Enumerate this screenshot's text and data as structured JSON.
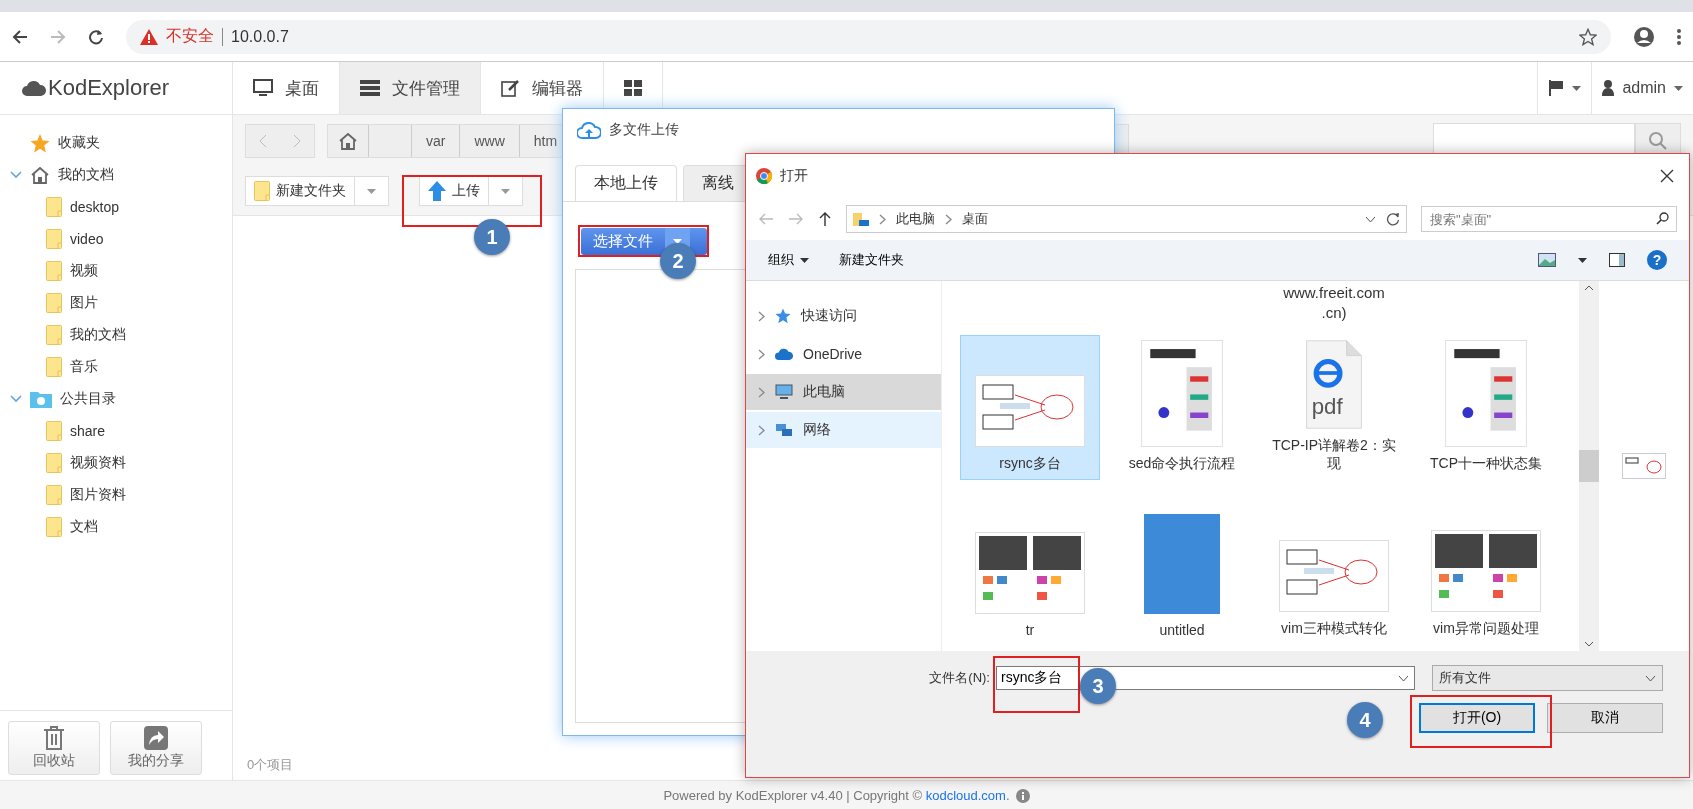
{
  "browser": {
    "warning": "不安全",
    "url": "10.0.0.7"
  },
  "app": {
    "logo": "KodExplorer",
    "nav": [
      {
        "label": "桌面",
        "selected": false,
        "kind": "desktop"
      },
      {
        "label": "文件管理",
        "selected": true,
        "kind": "files"
      },
      {
        "label": "编辑器",
        "selected": false,
        "kind": "editor"
      },
      {
        "kind": "apps",
        "selected": false
      }
    ],
    "user": "admin"
  },
  "sidebar": {
    "items": [
      {
        "label": "收藏夹",
        "kind": "star"
      },
      {
        "label": "我的文档",
        "kind": "home",
        "expanded": true,
        "children": [
          {
            "label": "desktop"
          },
          {
            "label": "video"
          },
          {
            "label": "视频"
          },
          {
            "label": "图片"
          },
          {
            "label": "我的文档"
          },
          {
            "label": "音乐"
          }
        ]
      },
      {
        "label": "公共目录",
        "kind": "public",
        "expanded": true,
        "children": [
          {
            "label": "share"
          },
          {
            "label": "视频资料"
          },
          {
            "label": "图片资料"
          },
          {
            "label": "文档"
          }
        ]
      }
    ],
    "buttons": [
      {
        "label": "回收站",
        "kind": "trash"
      },
      {
        "label": "我的分享",
        "kind": "share"
      }
    ]
  },
  "breadcrumb": [
    "var",
    "www",
    "htm"
  ],
  "toolbar": {
    "new_folder": "新建文件夹",
    "upload": "上传"
  },
  "status": "0个项目",
  "footer": {
    "text": "Powered by KodExplorer v4.40 | Copyright © ",
    "link": "kodcloud.com",
    "end": "."
  },
  "upload_dialog": {
    "title": "多文件上传",
    "tabs": [
      {
        "label": "本地上传",
        "selected": true
      },
      {
        "label": "离线",
        "selected": false
      }
    ],
    "button": "选择文件"
  },
  "open_dialog": {
    "title": "打开",
    "path": [
      "此电脑",
      "桌面"
    ],
    "search_placeholder": "搜索\"桌面\"",
    "organize": "组织",
    "help": "?",
    "new_folder": "新建文件夹",
    "nav": [
      {
        "label": "快速访问",
        "kind": "quick",
        "selected": false
      },
      {
        "label": "OneDrive",
        "kind": "cloud",
        "selected": false
      },
      {
        "label": "此电脑",
        "kind": "pc",
        "selected": true
      },
      {
        "label": "网络",
        "kind": "network",
        "selected": false,
        "hovered": true
      }
    ],
    "partial_label": "www.freeit.com .cn)",
    "files": [
      {
        "name": "rsync多台",
        "kind": "diagram",
        "selected": true
      },
      {
        "name": "sed命令执行流程",
        "kind": "flowchart",
        "selected": false
      },
      {
        "name": "TCP-IP详解卷2：实现",
        "kind": "pdf",
        "selected": false
      },
      {
        "name": "TCP十一种状态集",
        "kind": "flowchart",
        "selected": false
      },
      {
        "name": "tr",
        "kind": "slides",
        "selected": false
      },
      {
        "name": "untitled",
        "kind": "photo",
        "selected": false
      },
      {
        "name": "vim三种模式转化",
        "kind": "diagram",
        "selected": false
      },
      {
        "name": "vim异常问题处理",
        "kind": "slides",
        "selected": false
      }
    ],
    "filename_label": "文件名(N):",
    "filename": "rsync多台",
    "filetype": "所有文件",
    "open": "打开(O)",
    "cancel": "取消"
  },
  "annotations": [
    "1",
    "2",
    "3",
    "4"
  ]
}
